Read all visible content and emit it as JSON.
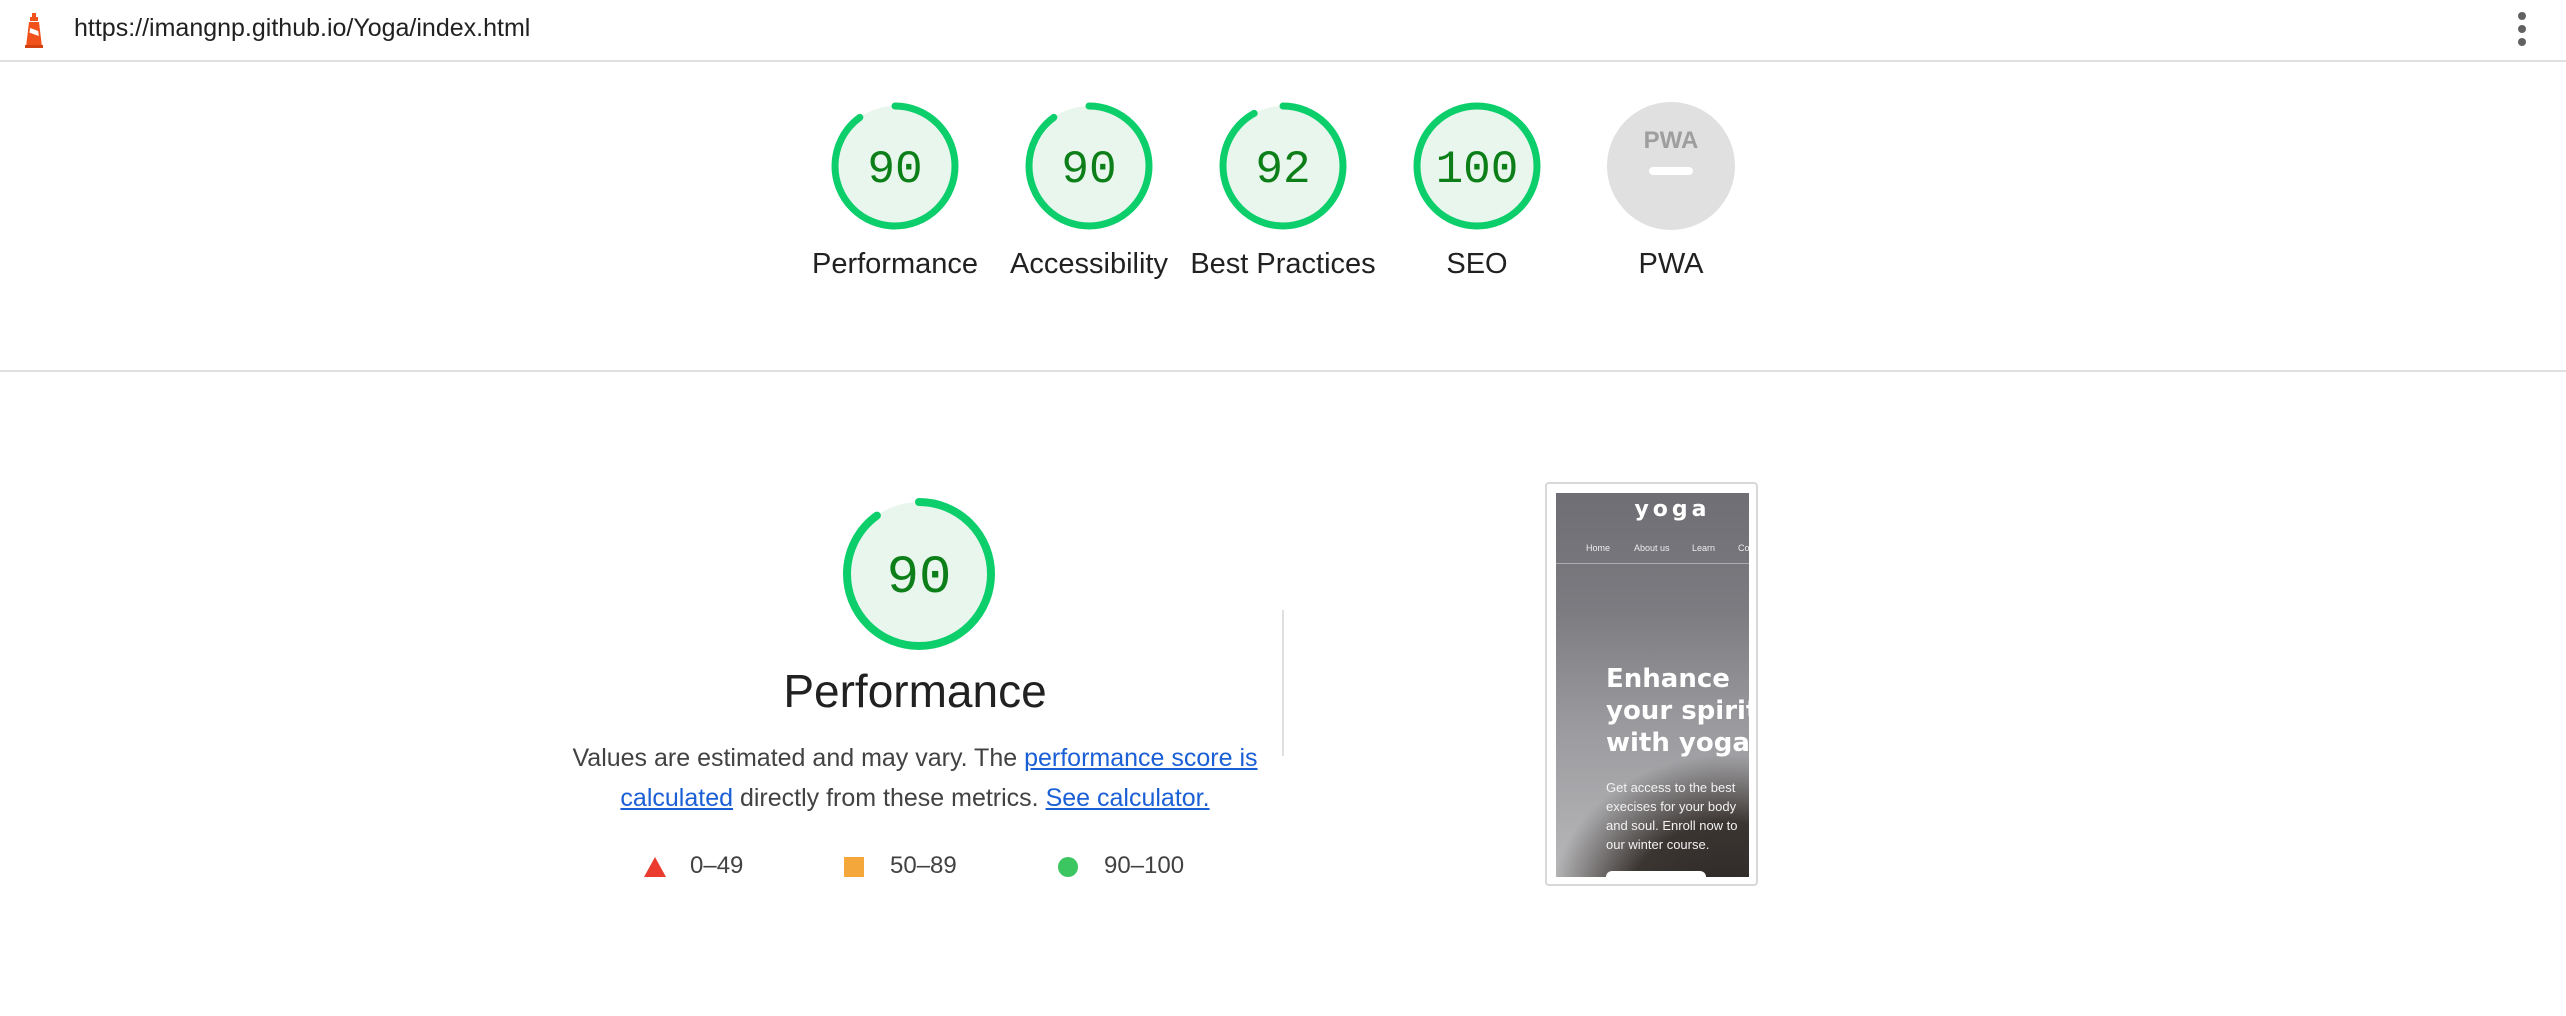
{
  "topbar": {
    "url": "https://imangnp.github.io/Yoga/index.html"
  },
  "gauges": [
    {
      "label": "Performance",
      "score": "90",
      "color": "#0cce6b"
    },
    {
      "label": "Accessibility",
      "score": "90",
      "color": "#0cce6b"
    },
    {
      "label": "Best Practices",
      "score": "92",
      "color": "#0cce6b"
    },
    {
      "label": "SEO",
      "score": "100",
      "color": "#0cce6b"
    },
    {
      "label": "PWA",
      "score": "",
      "color": "#9e9e9e"
    }
  ],
  "pwa_badge_text": "PWA",
  "performance": {
    "score": "90",
    "title": "Performance",
    "desc_before": "Values are estimated and may vary. The ",
    "desc_link": "performance score is calculated",
    "desc_middle": " directly from these metrics. ",
    "desc_calc_link": "See calculator.",
    "legend": [
      {
        "range": "0–49",
        "shape": "triangle",
        "color": "#eb3b2f"
      },
      {
        "range": "50–89",
        "shape": "square",
        "color": "#f4a83b"
      },
      {
        "range": "90–100",
        "shape": "circle",
        "color": "#3cc661"
      }
    ]
  },
  "screenshot": {
    "brand": "yoga",
    "nav": [
      "Home",
      "About us",
      "Learn",
      "Co"
    ],
    "hero_lines": [
      "Enhance",
      "your spirit",
      "with yoga"
    ],
    "body_lines": [
      "Get access to the best",
      "execises for your body",
      "and soul. Enroll now to",
      "our winter course."
    ]
  },
  "colors": {
    "pass_stroke": "#0cce6b",
    "pass_fill": "#e8f6ed",
    "pass_text": "#0d7f19",
    "link": "#1a5fd6",
    "brand_logo": "#f1511b"
  }
}
